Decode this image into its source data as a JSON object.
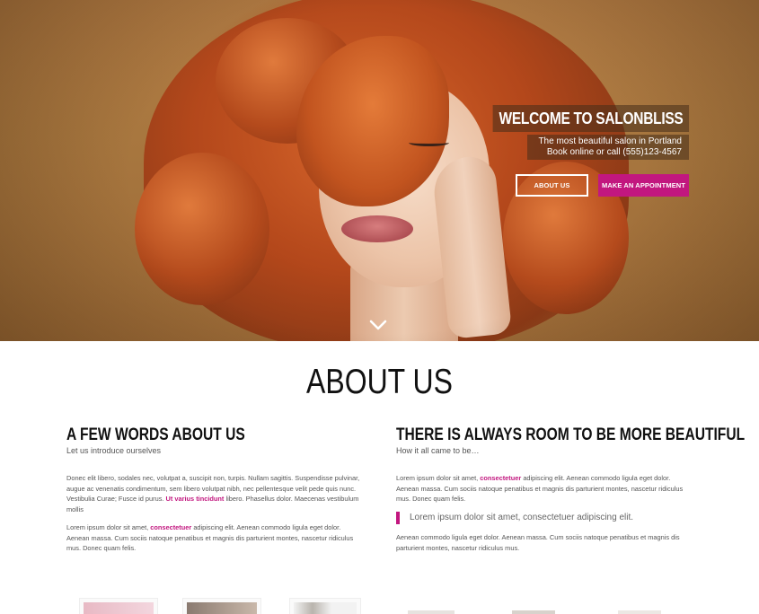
{
  "hero": {
    "title": "WELCOME TO SALONBLISS",
    "subtitle_line1": "The most beautiful salon in Portland",
    "subtitle_line2": "Book online or call (555)123-4567",
    "about_button": "ABOUT US",
    "appointment_button": "MAKE AN APPOINTMENT",
    "scroll_icon": "chevron-down-icon"
  },
  "about": {
    "heading": "ABOUT US",
    "left": {
      "title_plain": "A FEW WORDS ",
      "title_bold": "ABOUT US",
      "subtitle": "Let us introduce ourselves",
      "para1_a": "Donec elit libero, sodales nec, volutpat a, suscipit non, turpis. Nullam sagittis. Suspendisse pulvinar, augue ac venenatis condimentum, sem libero volutpat nibh, nec pellentesque velit pede quis nunc. Vestibulia Curae; Fusce id purus. ",
      "para1_link": "Ut varius tincidunt",
      "para1_b": " libero. Phasellus dolor. Maecenas vestibulum mollis",
      "para2_a": "Lorem ipsum dolor sit amet, ",
      "para2_link": "consectetuer",
      "para2_b": " adipiscing elit. Aenean commodo ligula eget dolor. Aenean massa. Cum sociis natoque penatibus et magnis dis parturient montes, nascetur ridiculus mus. Donec quam felis."
    },
    "right": {
      "title_plain": "THERE IS ALWAYS ROOM TO BE ",
      "title_bold": "MORE BEAUTIFUL",
      "subtitle": "How it all came to be…",
      "para1_a": "Lorem ipsum dolor sit amet, ",
      "para1_link": "consectetuer",
      "para1_b": " adipiscing elit. Aenean commodo ligula eget dolor. Aenean massa. Cum sociis natoque penatibus et magnis dis parturient montes, nascetur ridiculus mus. Donec quam felis.",
      "quote": "Lorem ipsum dolor sit amet, consectetuer adipiscing elit.",
      "para2": "Aenean commodo ligula eget dolor. Aenean massa. Cum sociis natoque penatibus et magnis dis parturient montes, nascetur ridiculus mus."
    }
  },
  "colors": {
    "accent": "#c2177f",
    "heading": "#111111",
    "body_text": "#555555"
  }
}
